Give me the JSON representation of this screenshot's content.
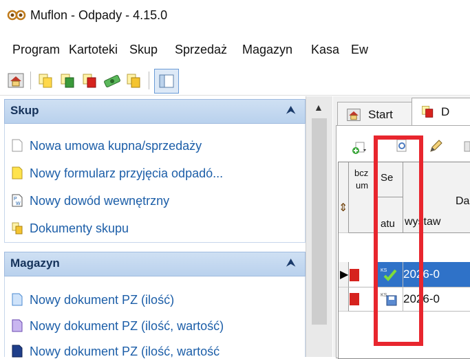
{
  "app": {
    "title": "Muflon - Odpady - 4.15.0",
    "logo_icon": "muflon-logo-icon"
  },
  "menu": [
    "Program",
    "Kartoteki",
    "Skup",
    "Sprzedaż",
    "Magazyn",
    "Kasa",
    "Ew"
  ],
  "toolbar": [
    "home-icon",
    "documents-icon",
    "documents-green-icon",
    "documents-red-icon",
    "money-icon",
    "documents-yellow-icon",
    "panel-toggle-icon"
  ],
  "left_panel": {
    "skup": {
      "title": "Skup",
      "collapse_icon": "double-chevron-up-icon",
      "items": [
        {
          "label": "Nowa umowa kupna/sprzedaży",
          "icon": "blank-document-icon"
        },
        {
          "label": "Nowy formularz przyjęcia odpadó...",
          "icon": "yellow-document-icon"
        },
        {
          "label": "Nowy dowód wewnętrzny",
          "icon": "internal-document-icon"
        },
        {
          "label": "Dokumenty skupu",
          "icon": "documents-folder-icon"
        }
      ]
    },
    "magazyn": {
      "title": "Magazyn",
      "collapse_icon": "double-chevron-up-icon",
      "items": [
        {
          "label": "Nowy dokument PZ (ilość)",
          "icon": "blue-document-icon"
        },
        {
          "label": "Nowy dokument PZ (ilość, wartość)",
          "icon": "purple-document-icon"
        },
        {
          "label": "Nowy dokument PZ (ilość, wartość",
          "icon": "navy-document-icon"
        }
      ]
    }
  },
  "tabs": [
    {
      "label": "Start",
      "icon": "home-icon"
    },
    {
      "label": "D",
      "icon": "documents-red-icon"
    }
  ],
  "grid": {
    "headers": {
      "col1_top": "bcz",
      "col1_bottom": "um",
      "col2_top": "Se",
      "col2_bottom": "atu",
      "col3_top": "Da",
      "col3_bottom": "wystaw"
    },
    "rows": [
      {
        "date": "2026-0",
        "status_icon": "ks-check-icon",
        "selected": true
      },
      {
        "date": "2026-0",
        "status_icon": "ks-save-icon",
        "selected": false
      }
    ]
  },
  "colors": {
    "highlight": "#e8262e",
    "selection": "#2f72c8",
    "link": "#1c5ea8"
  }
}
